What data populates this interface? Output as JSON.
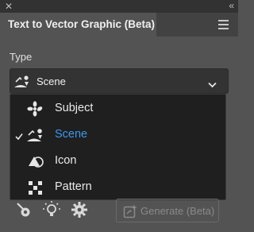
{
  "window": {
    "close_glyph": "✕",
    "collapse_glyph": "«"
  },
  "panel": {
    "title": "Text to Vector Graphic (Beta)",
    "menu_icon": "hamburger-menu-icon"
  },
  "type_field": {
    "label": "Type",
    "selected_value": "Scene",
    "selected_icon": "scene-icon",
    "chevron_icon": "chevron-down-icon"
  },
  "dropdown": {
    "options": [
      {
        "label": "Subject",
        "icon": "subject-icon",
        "selected": false
      },
      {
        "label": "Scene",
        "icon": "scene-icon",
        "selected": true
      },
      {
        "label": "Icon",
        "icon": "icon-type-icon",
        "selected": false
      },
      {
        "label": "Pattern",
        "icon": "pattern-icon",
        "selected": false
      }
    ]
  },
  "toolbar": {
    "tools": [
      "sample-style-icon",
      "lightbulb-icon",
      "settings-gear-icon"
    ],
    "generate_label": "Generate (Beta)",
    "generate_icon": "generate-icon"
  },
  "colors": {
    "panel_bg": "#535353",
    "dropdown_bg": "#1f1f1f",
    "accent": "#3e97f0",
    "text": "#eaeaea"
  }
}
